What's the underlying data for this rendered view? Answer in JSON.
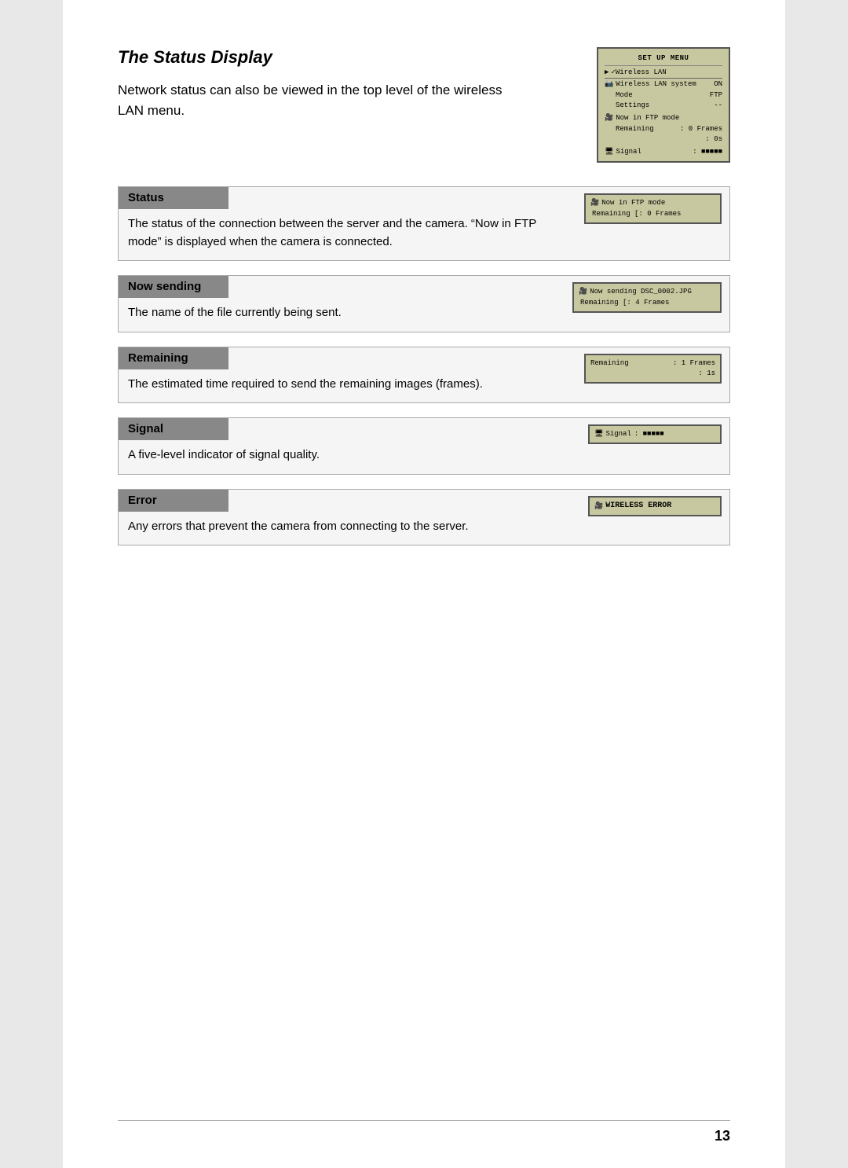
{
  "page": {
    "title": "The Status Display",
    "intro": "Network status can also be viewed in the top level of the wireless LAN menu.",
    "page_number": "13"
  },
  "setup_menu": {
    "title": "SET UP MENU",
    "wireless_lan": "✓Wireless LAN",
    "system_label": "Wireless LAN system",
    "system_value": "ON",
    "mode_label": "Mode",
    "mode_value": "FTP",
    "settings_label": "Settings",
    "settings_value": "--",
    "ftp_mode": "Now in FTP mode",
    "remaining_label": "Remaining",
    "remaining_frames": ": 0 Frames",
    "remaining_time": ": 0s",
    "signal_label": "Signal",
    "signal_value": ": ■■■■■"
  },
  "sections": [
    {
      "id": "status",
      "header": "Status",
      "description": "The status of the connection between the server and the camera. “Now in FTP mode” is displayed when the camera is connected.",
      "lcd_lines": [
        "Now in FTP mode",
        "Remaining  [: 0 Frames"
      ]
    },
    {
      "id": "now-sending",
      "header": "Now sending",
      "description": "The name of the file currently being sent.",
      "lcd_lines": [
        "Now sending DSC_0002.JPG",
        "Remaining  [: 4 Frames"
      ]
    },
    {
      "id": "remaining",
      "header": "Remaining",
      "description": "The estimated time required to send the remaining images (frames).",
      "lcd_lines": [
        "Remaining  : 1 Frames",
        "           : 1s"
      ]
    },
    {
      "id": "signal",
      "header": "Signal",
      "description": "A five-level indicator of signal quality.",
      "lcd_lines": [
        "Signal     : ■■■■■"
      ]
    },
    {
      "id": "error",
      "header": "Error",
      "description": "Any errors that prevent the camera from connecting to the server.",
      "lcd_lines": [
        "WIRELESS ERROR"
      ]
    }
  ]
}
